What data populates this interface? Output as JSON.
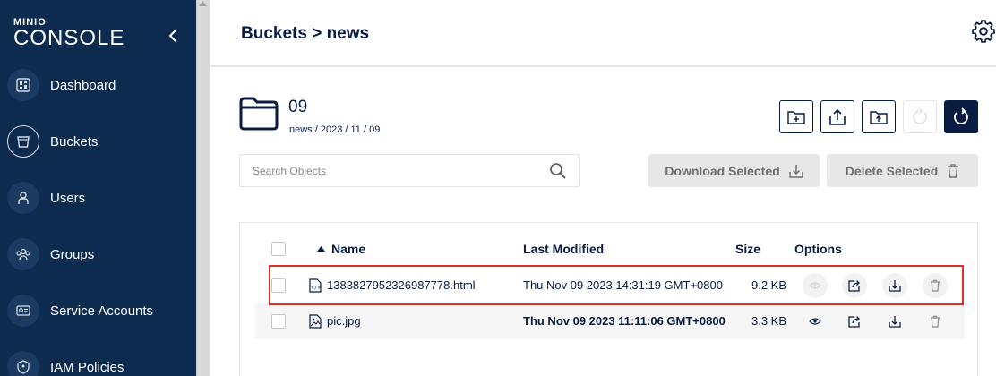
{
  "sidebar": {
    "brand": "MINIO",
    "console": "CONSOLE",
    "items": [
      {
        "label": "Dashboard",
        "icon": "dashboard-icon"
      },
      {
        "label": "Buckets",
        "icon": "bucket-icon",
        "active": true
      },
      {
        "label": "Users",
        "icon": "user-icon"
      },
      {
        "label": "Groups",
        "icon": "groups-icon"
      },
      {
        "label": "Service Accounts",
        "icon": "service-accounts-icon"
      },
      {
        "label": "IAM Policies",
        "icon": "shield-icon"
      }
    ]
  },
  "header": {
    "title": "Buckets > news"
  },
  "folder": {
    "name": "09",
    "path": "news / 2023 / 11 / 09"
  },
  "search": {
    "placeholder": "Search Objects"
  },
  "actions": {
    "download": "Download Selected",
    "delete": "Delete Selected"
  },
  "table": {
    "columns": {
      "name": "Name",
      "modified": "Last Modified",
      "size": "Size",
      "options": "Options"
    },
    "rows": [
      {
        "name": "1383827952326987778.html",
        "modified": "Thu Nov 09 2023 14:31:19 GMT+0800",
        "size": "9.2 KB",
        "type": "html"
      },
      {
        "name": "pic.jpg",
        "modified": "Thu Nov 09 2023 11:11:06 GMT+0800",
        "size": "3.3 KB",
        "type": "image"
      }
    ]
  },
  "colors": {
    "sidebar": "#0d2a4f",
    "primary": "#081c42",
    "highlight": "#d9302f"
  }
}
